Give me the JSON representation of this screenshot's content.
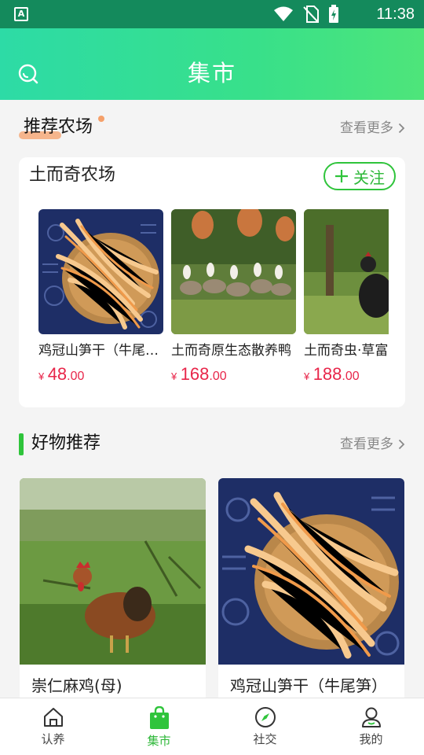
{
  "status_bar": {
    "app_indicator": "A",
    "time": "11:38",
    "icons": [
      "wifi-icon",
      "no-sim-icon",
      "battery-charging-icon"
    ]
  },
  "header": {
    "title": "集市",
    "search_icon": "search-icon"
  },
  "recommended_farms": {
    "title": "推荐农场",
    "more_label": "查看更多",
    "farm": {
      "name": "土而奇农场",
      "follow_label": "关注",
      "items": [
        {
          "name": "鸡冠山笋干（牛尾笋）",
          "currency": "¥",
          "price_int": "48",
          "price_dec": ".00"
        },
        {
          "name": "土而奇原生态散养鸭",
          "currency": "¥",
          "price_int": "168",
          "price_dec": ".00"
        },
        {
          "name": "土而奇虫·草富",
          "currency": "¥",
          "price_int": "188",
          "price_dec": ".00"
        }
      ]
    }
  },
  "good_products": {
    "title": "好物推荐",
    "more_label": "查看更多",
    "items": [
      {
        "name": "崇仁麻鸡(母)"
      },
      {
        "name": "鸡冠山笋干（牛尾笋）"
      }
    ]
  },
  "bottom_nav": {
    "items": [
      {
        "label": "认养",
        "icon": "home-icon",
        "active": false
      },
      {
        "label": "集市",
        "icon": "shopping-bag-icon",
        "active": true
      },
      {
        "label": "社交",
        "icon": "compass-icon",
        "active": false
      },
      {
        "label": "我的",
        "icon": "user-icon",
        "active": false
      }
    ]
  },
  "colors": {
    "accent_green": "#2fc43b",
    "header_gradient_start": "#2ddba6",
    "header_gradient_end": "#4ee57a",
    "price_red": "#e8264a",
    "title_highlight": "#f5a06a"
  }
}
